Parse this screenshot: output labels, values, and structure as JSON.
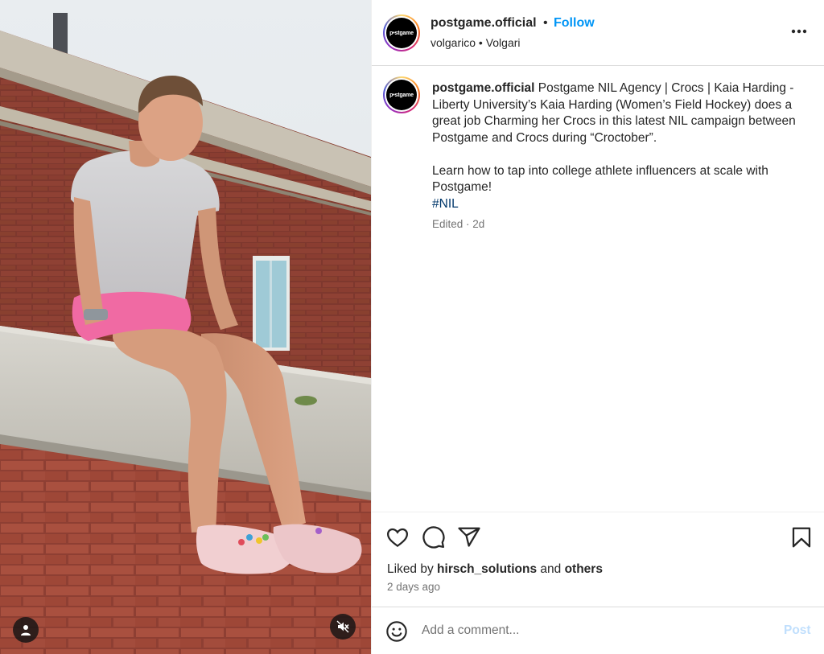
{
  "post": {
    "username": "postgame.official",
    "separator": "•",
    "follow_label": "Follow",
    "subtitle": "volgarico • Volgari",
    "avatar_text": "p•stgame",
    "caption_user": "postgame.official",
    "caption_p1": "Postgame NIL Agency | Crocs | Kaia Harding - Liberty University’s Kaia Harding (Women’s Field Hockey) does a great job Charming her Crocs in this latest NIL campaign between Postgame and Crocs during “Croctober”.",
    "caption_p2": "Learn how to tap into college athlete influencers at scale with Postgame!",
    "hashtag": "#NIL",
    "meta": "Edited · 2d"
  },
  "likes": {
    "prefix": "Liked by",
    "user": "hirsch_solutions",
    "and": "and",
    "others": "others",
    "time": "2 days ago"
  },
  "comment": {
    "placeholder": "Add a comment...",
    "post_label": "Post"
  },
  "icons": {
    "more": "more-options-icon",
    "like": "heart-icon",
    "comment": "comment-icon",
    "share": "share-icon",
    "save": "bookmark-icon",
    "emoji": "emoji-icon",
    "tag": "user-tag-icon",
    "mute": "speaker-muted-icon"
  },
  "colors": {
    "follow": "#0095f6",
    "hashtag": "#00376b",
    "post_disabled": "#c0dffd",
    "secondary_text": "#737373"
  }
}
